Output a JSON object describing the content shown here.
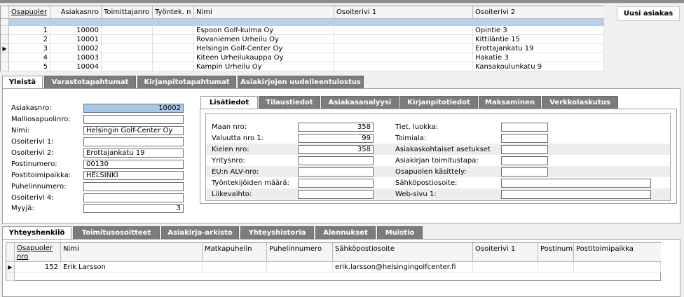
{
  "top_grid": {
    "columns": [
      "Osapuoler",
      "Asiakasnro",
      "Toimittajanro",
      "Työntek. n",
      "Nimi",
      "Osoiterivi 1",
      "Osoiterivi 2"
    ],
    "rows": [
      {
        "id": "1",
        "asiakasnro": "10000",
        "nimi": "Espoon Golf-kulma Oy",
        "osoite1": "",
        "osoite2": "Opintie 3"
      },
      {
        "id": "2",
        "asiakasnro": "10001",
        "nimi": "Rovaniemen Urheilu Oy",
        "osoite1": "",
        "osoite2": "Kittiläntie 15"
      },
      {
        "id": "3",
        "asiakasnro": "10002",
        "nimi": "Helsingin Golf-Center Oy",
        "osoite1": "",
        "osoite2": "Erottajankatu 19"
      },
      {
        "id": "4",
        "asiakasnro": "10003",
        "nimi": "Kiteen Urheilukauppa Oy",
        "osoite1": "",
        "osoite2": "Hakatie 3"
      },
      {
        "id": "5",
        "asiakasnro": "10004",
        "nimi": "Kampin Urheilu Oy",
        "osoite1": "",
        "osoite2": "Kansakoulunkatu 9"
      }
    ]
  },
  "new_customer_button": "Uusi asiakas",
  "main_tabs": [
    "Yleistä",
    "Varastotapahtumat",
    "Kirjanpitotapahtumat",
    "Asiakirjojen uudelleentulostus"
  ],
  "general_form": {
    "asiakasnro": {
      "label": "Asiakasnro:",
      "value": "10002"
    },
    "malliosapuolinro": {
      "label": "Malliosapuolinro:",
      "value": ""
    },
    "nimi": {
      "label": "Nimi:",
      "value": "Helsingin Golf-Center Oy"
    },
    "osoiterivi1": {
      "label": "Osoiterivi 1:",
      "value": ""
    },
    "osoiterivi2": {
      "label": "Osoiterivi 2:",
      "value": "Erottajankatu 19"
    },
    "postinumero": {
      "label": "Postinumero:",
      "value": "00130"
    },
    "postitoimipaikka": {
      "label": "Postitoimipaikka:",
      "value": "HELSINKI"
    },
    "puhelinnumero": {
      "label": "Puhelinnumero:",
      "value": ""
    },
    "osoiterivi4": {
      "label": "Osoiterivi 4:",
      "value": ""
    },
    "myyja": {
      "label": "Myyjä:",
      "value": "3"
    }
  },
  "detail_tabs": [
    "Lisätiedot",
    "Tilaustiedot",
    "Asiakasanalyysi",
    "Kirjanpitotiedot",
    "Maksaminen",
    "Verkkolaskutus"
  ],
  "lisatiedot": {
    "left": [
      {
        "label": "Maan nro:",
        "value": "358"
      },
      {
        "label": "Valuutta nro 1:",
        "value": "99"
      },
      {
        "label": "Kielen nro:",
        "value": "358"
      },
      {
        "label": "Yritysnro:",
        "value": ""
      },
      {
        "label": "EU:n ALV-nro:",
        "value": ""
      },
      {
        "label": "Työntekijöiden määrä:",
        "value": ""
      },
      {
        "label": "Liikevaihto:",
        "value": ""
      }
    ],
    "right": [
      {
        "label": "Tiet. luokka:",
        "value": ""
      },
      {
        "label": "Toimiala:",
        "value": ""
      },
      {
        "label": "Asiakaskohtaiset asetukset",
        "value": ""
      },
      {
        "label": "Asiakirjan toimitustapa:",
        "value": ""
      },
      {
        "label": "Osapuolen käsittely:",
        "value": ""
      },
      {
        "label": "Sähköpostiosoite:",
        "value": ""
      },
      {
        "label": "Web-sivu 1:",
        "value": ""
      }
    ]
  },
  "bottom_tabs": [
    "Yhteyshenkilö",
    "Toimitusosoitteet",
    "Asiakirja-arkisto",
    "Yhteyshistoria",
    "Alennukset",
    "Muistio"
  ],
  "contact_grid": {
    "columns": [
      "Osapuoler nro",
      "Nimi",
      "Matkapuhelin",
      "Puhelinnumero",
      "Sähköpostiosoite",
      "Osoiterivi 1",
      "Postinum",
      "Postitoimipaikka"
    ],
    "rows": [
      {
        "nro": "152",
        "nimi": "Erik Larsson",
        "matkapuhelin": "",
        "puhelin": "",
        "email": "erik.larsson@helsingingolfcenter.fi",
        "osoite1": "",
        "postinum": "",
        "postitoimipaikka": ""
      }
    ]
  }
}
